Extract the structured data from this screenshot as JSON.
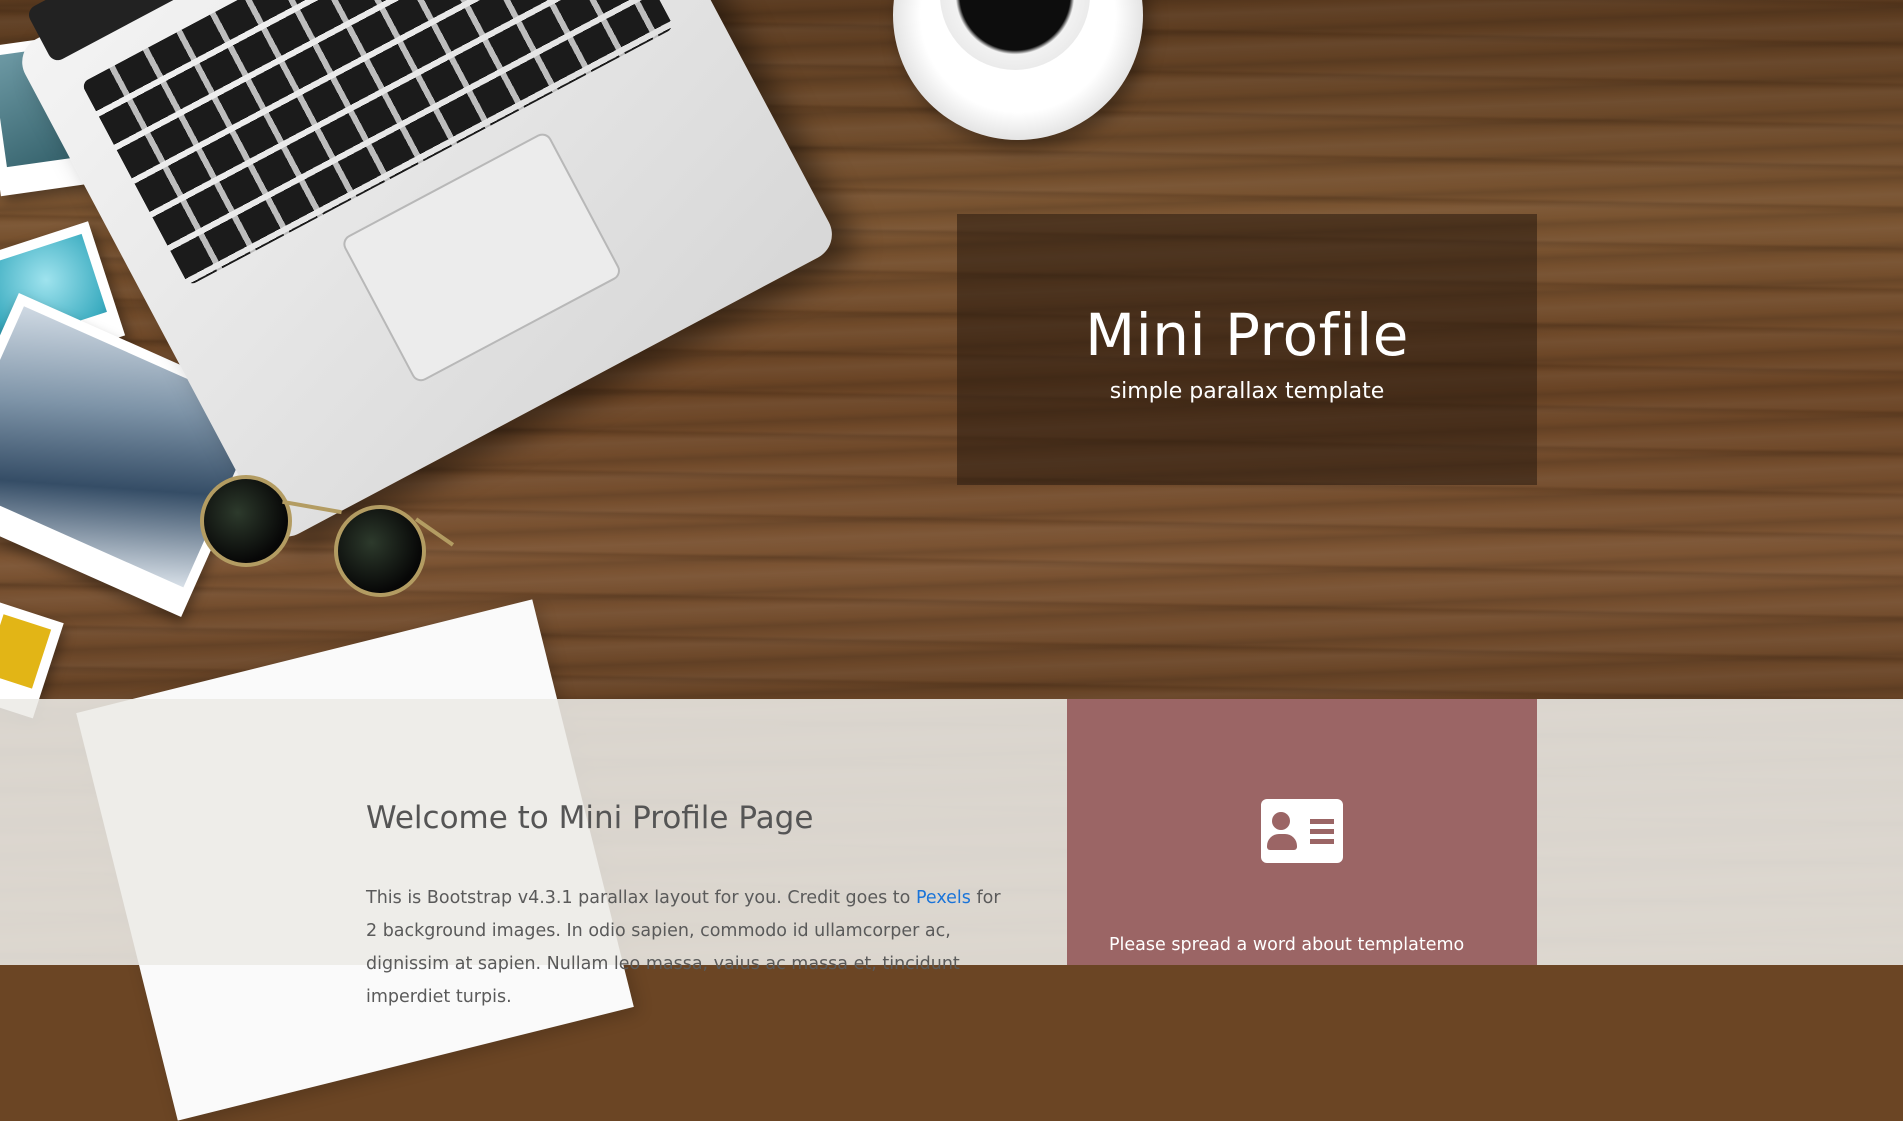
{
  "hero": {
    "title": "Mini Profile",
    "subtitle": "simple parallax template"
  },
  "welcome": {
    "heading": "Welcome to Mini Profile Page",
    "intro_before_link": "This is Bootstrap v4.3.1 parallax layout for you. Credit goes to ",
    "link_text": "Pexels",
    "intro_after_link": " for 2 background images. In odio sapien, commodo id ullamcorper ac, dignissim at sapien. Nullam leo massa, vaius ac massa et, tincidunt imperdiet turpis."
  },
  "card": {
    "icon": "address-card-icon",
    "text": "Please spread a word about templatemo"
  },
  "colors": {
    "hero_box_overlay": "#281910",
    "card_background": "#9b6565",
    "link": "#1a74d9",
    "lower_section_overlay": "#eceae6"
  }
}
